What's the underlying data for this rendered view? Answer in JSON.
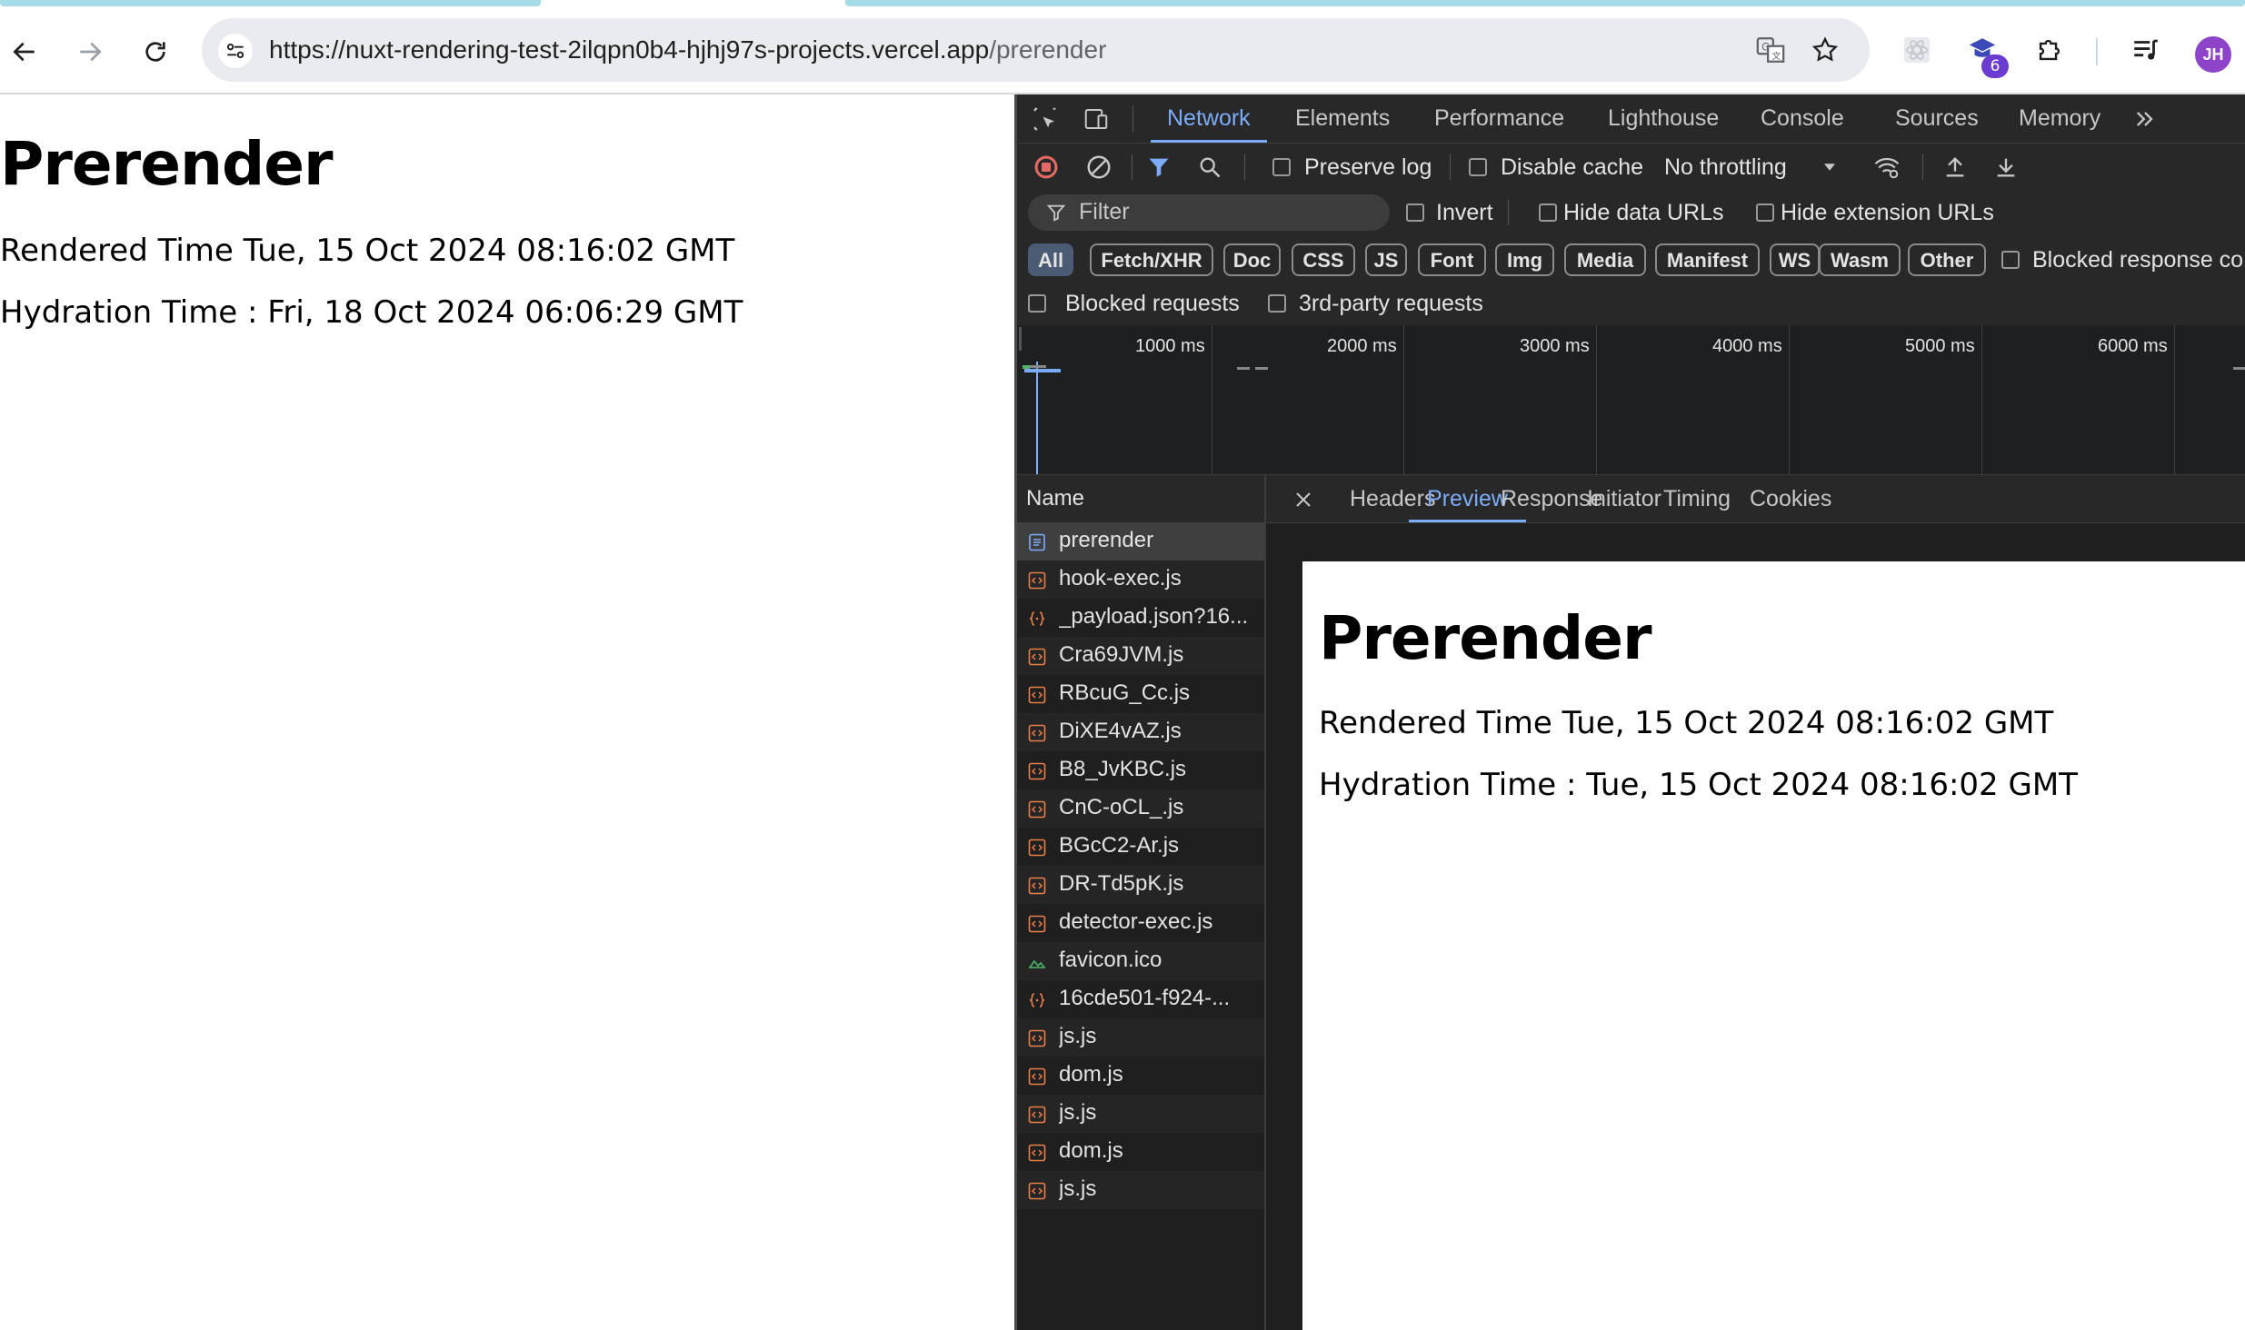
{
  "browser": {
    "url_host": "https://nuxt-rendering-test-2ilqpn0b4-hjhj97s-projects.vercel.app",
    "url_path": "/prerender",
    "extension_badge": "6",
    "avatar_initials": "JH",
    "icons": [
      "back-arrow-icon",
      "forward-arrow-icon",
      "reload-icon",
      "site-settings-icon",
      "translate-icon",
      "bookmark-star-icon",
      "react-devtools-icon",
      "graduation-cap-extension-icon",
      "puzzle-extensions-icon",
      "media-queue-icon"
    ]
  },
  "page": {
    "title": "Prerender",
    "rendered_line": "Rendered Time Tue, 15 Oct 2024 08:16:02 GMT",
    "hydration_line": "Hydration Time : Fri, 18 Oct 2024 06:06:29 GMT"
  },
  "devtools": {
    "tabs": [
      "Network",
      "Elements",
      "Performance",
      "Lighthouse",
      "Console",
      "Sources",
      "Memory"
    ],
    "active_tab": "Network",
    "toolbar": {
      "preserve_log": "Preserve log",
      "disable_cache": "Disable cache",
      "throttling": "No throttling"
    },
    "filter_bar": {
      "placeholder": "Filter",
      "invert": "Invert",
      "hide_data_urls": "Hide data URLs",
      "hide_extension_urls": "Hide extension URLs"
    },
    "type_filters": [
      "All",
      "Fetch/XHR",
      "Doc",
      "CSS",
      "JS",
      "Font",
      "Img",
      "Media",
      "Manifest",
      "WS",
      "Wasm",
      "Other"
    ],
    "blocked_response": "Blocked response co",
    "blocked_requests": "Blocked requests",
    "third_party": "3rd-party requests",
    "timeline_ticks": [
      "1000 ms",
      "2000 ms",
      "3000 ms",
      "4000 ms",
      "5000 ms",
      "6000 ms"
    ],
    "name_header": "Name",
    "requests": [
      {
        "name": "prerender",
        "type": "doc"
      },
      {
        "name": "hook-exec.js",
        "type": "script"
      },
      {
        "name": "_payload.json?16...",
        "type": "fetch"
      },
      {
        "name": "Cra69JVM.js",
        "type": "script"
      },
      {
        "name": "RBcuG_Cc.js",
        "type": "script"
      },
      {
        "name": "DiXE4vAZ.js",
        "type": "script"
      },
      {
        "name": "B8_JvKBC.js",
        "type": "script"
      },
      {
        "name": "CnC-oCL_.js",
        "type": "script"
      },
      {
        "name": "BGcC2-Ar.js",
        "type": "script"
      },
      {
        "name": "DR-Td5pK.js",
        "type": "script"
      },
      {
        "name": "detector-exec.js",
        "type": "script"
      },
      {
        "name": "favicon.ico",
        "type": "image"
      },
      {
        "name": "16cde501-f924-...",
        "type": "fetch"
      },
      {
        "name": "js.js",
        "type": "script"
      },
      {
        "name": "dom.js",
        "type": "script"
      },
      {
        "name": "js.js",
        "type": "script"
      },
      {
        "name": "dom.js",
        "type": "script"
      },
      {
        "name": "js.js",
        "type": "script"
      }
    ],
    "detail_tabs": [
      "Headers",
      "Preview",
      "Response",
      "Initiator",
      "Timing",
      "Cookies"
    ],
    "active_detail_tab": "Preview",
    "preview": {
      "title": "Prerender",
      "rendered_line": "Rendered Time Tue, 15 Oct 2024 08:16:02 GMT",
      "hydration_line": "Hydration Time : Tue, 15 Oct 2024 08:16:02 GMT"
    },
    "colors": {
      "accent": "#7cacf8",
      "record": "#e46962",
      "script_icon": "#e8804a",
      "image_icon": "#4fb36b",
      "doc_icon": "#7cacf8"
    }
  }
}
